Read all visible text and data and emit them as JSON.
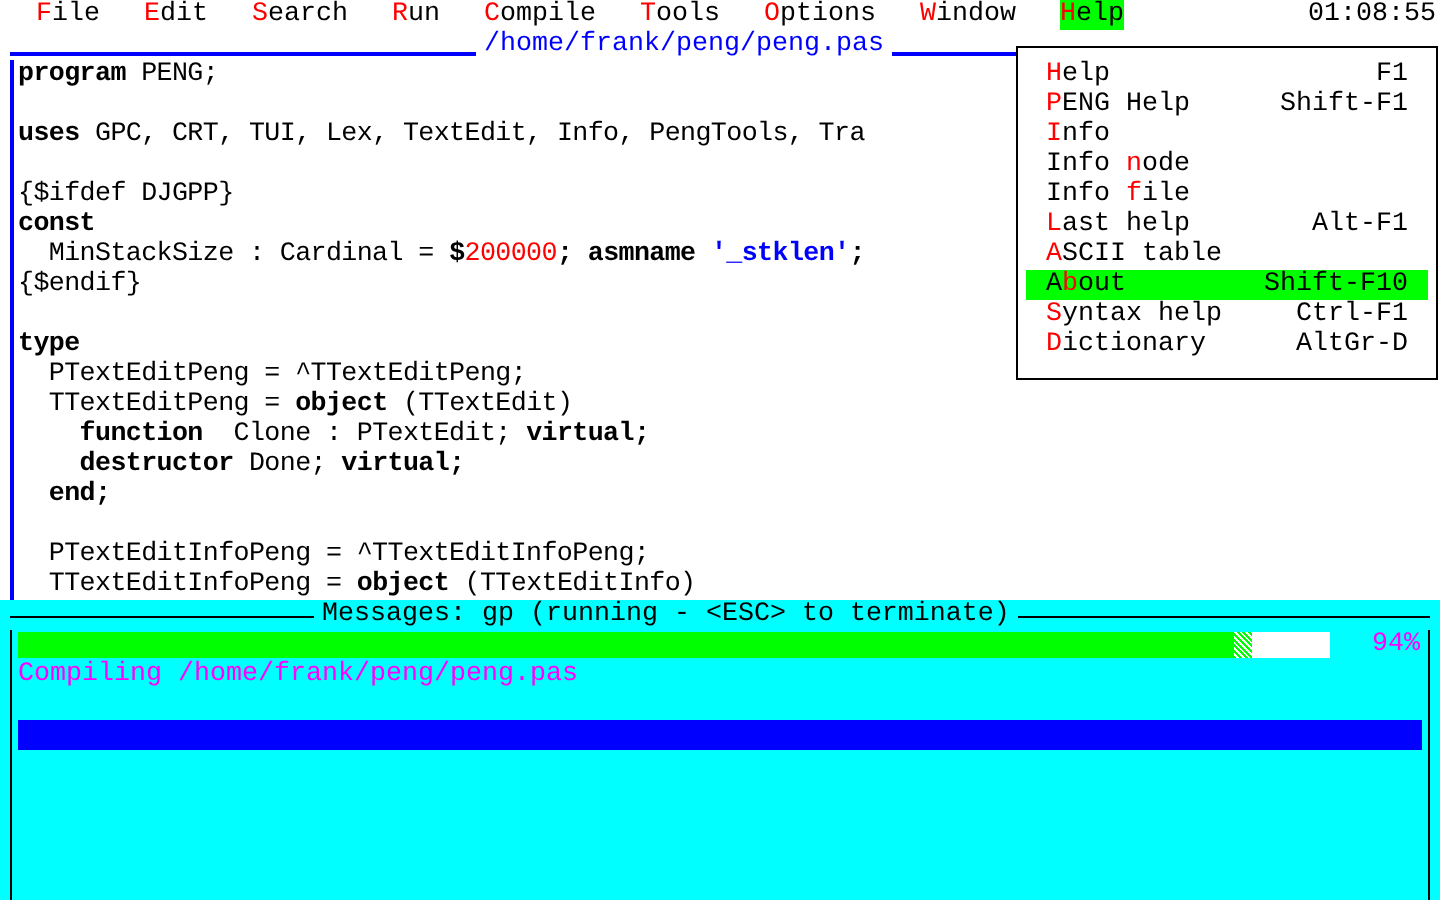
{
  "menu_bar": [
    {
      "hotkey": "F",
      "after": "ile",
      "selected": false
    },
    {
      "hotkey": "E",
      "after": "dit",
      "selected": false
    },
    {
      "hotkey": "S",
      "after": "earch",
      "selected": false
    },
    {
      "hotkey": "R",
      "after": "un",
      "selected": false
    },
    {
      "hotkey": "C",
      "after": "ompile",
      "selected": false
    },
    {
      "hotkey": "T",
      "after": "ools",
      "selected": false
    },
    {
      "hotkey": "O",
      "after": "ptions",
      "selected": false
    },
    {
      "hotkey": "W",
      "after": "indow",
      "selected": false
    },
    {
      "hotkey": "H",
      "after": "elp",
      "selected": true
    }
  ],
  "clock": "01:08:55",
  "editor": {
    "title": "/home/frank/peng/peng.pas",
    "lines": [
      {
        "kind": "code",
        "segments": [
          {
            "kind": "keyword",
            "text": "program"
          },
          {
            "kind": "plain",
            "text": " PENG;"
          }
        ]
      },
      {
        "kind": "blank"
      },
      {
        "kind": "code",
        "segments": [
          {
            "kind": "keyword",
            "text": "uses"
          },
          {
            "kind": "plain",
            "text": " GPC, CRT, TUI, Lex, TextEdit, Info, PengTools, Tra"
          }
        ]
      },
      {
        "kind": "blank"
      },
      {
        "kind": "code",
        "segments": [
          {
            "kind": "plain",
            "text": "{$ifdef DJGPP}"
          }
        ]
      },
      {
        "kind": "code",
        "segments": [
          {
            "kind": "keyword",
            "text": "const"
          }
        ]
      },
      {
        "kind": "code",
        "segments": [
          {
            "kind": "plain",
            "text": "  MinStackSize : Cardinal = "
          },
          {
            "kind": "keyword",
            "text": "$"
          },
          {
            "kind": "number",
            "text": "200000"
          },
          {
            "kind": "keyword",
            "text": "; asmname "
          },
          {
            "kind": "string",
            "text": "'_stklen'"
          },
          {
            "kind": "keyword",
            "text": ";"
          }
        ]
      },
      {
        "kind": "code",
        "segments": [
          {
            "kind": "plain",
            "text": "{$endif}"
          }
        ]
      },
      {
        "kind": "blank"
      },
      {
        "kind": "code",
        "segments": [
          {
            "kind": "keyword",
            "text": "type"
          }
        ]
      },
      {
        "kind": "code",
        "segments": [
          {
            "kind": "plain",
            "text": "  PTextEditPeng = ^TTextEditPeng;"
          }
        ]
      },
      {
        "kind": "code",
        "segments": [
          {
            "kind": "plain",
            "text": "  TTextEditPeng = "
          },
          {
            "kind": "keyword",
            "text": "object"
          },
          {
            "kind": "plain",
            "text": " (TTextEdit)"
          }
        ]
      },
      {
        "kind": "code",
        "segments": [
          {
            "kind": "keyword",
            "text": "    function"
          },
          {
            "kind": "plain",
            "text": "  Clone : PTextEdit; "
          },
          {
            "kind": "keyword",
            "text": "virtual;"
          }
        ]
      },
      {
        "kind": "code",
        "segments": [
          {
            "kind": "keyword",
            "text": "    destructor"
          },
          {
            "kind": "plain",
            "text": " Done; "
          },
          {
            "kind": "keyword",
            "text": "virtual;"
          }
        ]
      },
      {
        "kind": "code",
        "segments": [
          {
            "kind": "keyword",
            "text": "  end;"
          }
        ]
      },
      {
        "kind": "blank"
      },
      {
        "kind": "code",
        "segments": [
          {
            "kind": "plain",
            "text": "  PTextEditInfoPeng = ^TTextEditInfoPeng;"
          }
        ]
      },
      {
        "kind": "code",
        "segments": [
          {
            "kind": "plain",
            "text": "  TTextEditInfoPeng = "
          },
          {
            "kind": "keyword",
            "text": "object"
          },
          {
            "kind": "plain",
            "text": " (TTextEditInfo)"
          }
        ]
      }
    ]
  },
  "help_menu": [
    {
      "hotkey": "H",
      "after": "elp",
      "shortcut": "F1",
      "selected": false
    },
    {
      "hotkey": "P",
      "after": "ENG Help",
      "shortcut": "Shift-F1",
      "selected": false
    },
    {
      "hotkey": "I",
      "after": "nfo",
      "selected": false
    },
    {
      "before": "Info ",
      "hotkey": "n",
      "after": "ode",
      "selected": false
    },
    {
      "before": "Info ",
      "hotkey": "f",
      "after": "ile",
      "selected": false
    },
    {
      "hotkey": "L",
      "after": "ast help",
      "shortcut": "Alt-F1",
      "selected": false
    },
    {
      "hotkey": "A",
      "after": "SCII table",
      "selected": false
    },
    {
      "before": "A",
      "hotkey": "b",
      "after": "out",
      "shortcut": "Shift-F10",
      "selected": true
    },
    {
      "hotkey": "S",
      "after": "yntax help",
      "shortcut": "Ctrl-F1",
      "selected": false
    },
    {
      "hotkey": "D",
      "after": "ictionary",
      "shortcut": "AltGr-D",
      "selected": false
    }
  ],
  "messages": {
    "title": "Messages: gp (running - <ESC> to terminate)",
    "progress": {
      "level": 0.94,
      "reading": "94%"
    },
    "lines": [
      "Compiling /home/frank/peng/peng.pas"
    ]
  }
}
